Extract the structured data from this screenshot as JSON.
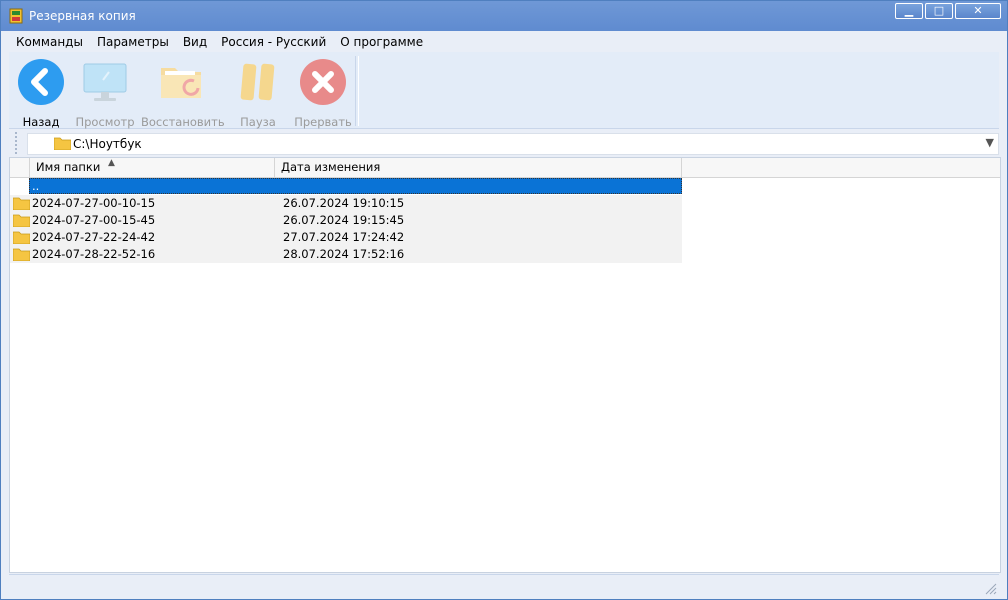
{
  "window": {
    "title": "Резервная копия",
    "controls": {
      "minimize": "▁",
      "maximize": "□",
      "close": "✕"
    }
  },
  "menu": [
    "Комманды",
    "Параметры",
    "Вид",
    "Россия - Русский",
    "О программе"
  ],
  "toolbar": {
    "back": {
      "label": "Назад",
      "icon": "back-arrow-icon",
      "color": "#2d9cf0",
      "enabled": true
    },
    "view": {
      "label": "Просмотр",
      "icon": "monitor-icon",
      "enabled": false
    },
    "restore": {
      "label": "Восстановить",
      "icon": "folder-restore-icon",
      "enabled": false
    },
    "pause": {
      "label": "Пауза",
      "icon": "pause-icon",
      "enabled": false
    },
    "abort": {
      "label": "Прервать",
      "icon": "abort-icon",
      "color": "#e05050",
      "enabled": false
    }
  },
  "address": {
    "path": "C:\\Ноутбук",
    "icon": "folder-icon"
  },
  "list": {
    "columns": [
      "Имя папки",
      "Дата изменения"
    ],
    "sort_indicator": "▲",
    "rows": [
      {
        "name": "..",
        "date": "",
        "selected": true
      },
      {
        "name": "2024-07-27-00-10-15",
        "date": "26.07.2024 19:10:15"
      },
      {
        "name": "2024-07-27-00-15-45",
        "date": "26.07.2024 19:15:45"
      },
      {
        "name": "2024-07-27-22-24-42",
        "date": "27.07.2024 17:24:42"
      },
      {
        "name": "2024-07-28-22-52-16",
        "date": "28.07.2024 17:52:16"
      }
    ]
  },
  "colors": {
    "titlebar": "#5f8bd0",
    "selection": "#0a73d6",
    "folder": "#f5c542"
  }
}
